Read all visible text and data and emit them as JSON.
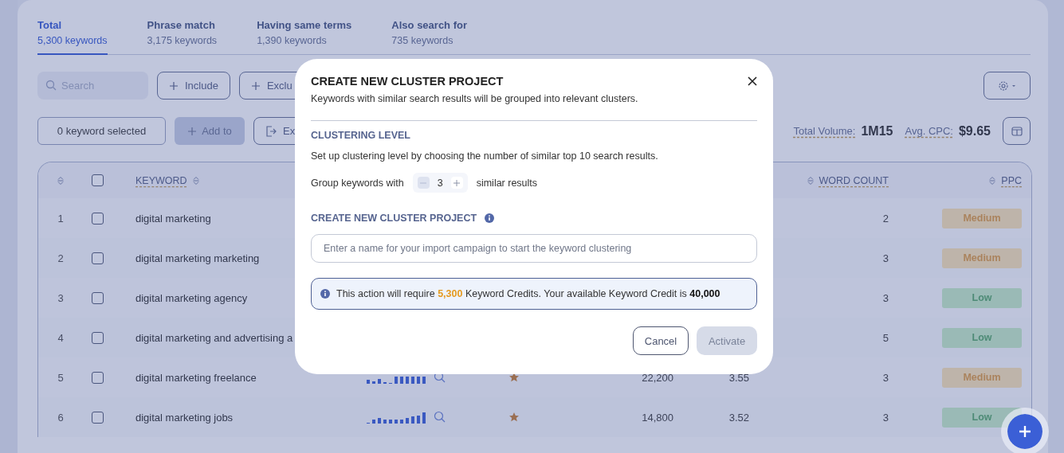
{
  "tabs": [
    {
      "title": "Total",
      "count": "5,300 keywords",
      "selected": true
    },
    {
      "title": "Phrase match",
      "count": "3,175 keywords",
      "selected": false
    },
    {
      "title": "Having same terms",
      "count": "1,390 keywords",
      "selected": false
    },
    {
      "title": "Also search for",
      "count": "735 keywords",
      "selected": false
    }
  ],
  "toolbar": {
    "search_placeholder": "Search",
    "include": "Include",
    "exclude": "Exclu",
    "selected_count": "0 keyword selected",
    "add_to": {
      "label": "Add to",
      "disabled": true
    },
    "export": "Ex",
    "total_volume_label": "Total Volume:",
    "total_volume": "1M15",
    "avg_cpc_label": "Avg. CPC:",
    "avg_cpc": "$9.65"
  },
  "table": {
    "header_checked": false,
    "columns": [
      "KEYWORD",
      "WORD COUNT",
      "PPC"
    ],
    "rows": [
      {
        "num": "1",
        "checked": false,
        "keyword": "digital marketing",
        "word_count": "2",
        "ppc": {
          "label": "Medium",
          "kind": "medium"
        }
      },
      {
        "num": "2",
        "checked": false,
        "keyword": "digital marketing marketing",
        "word_count": "3",
        "ppc": {
          "label": "Medium",
          "kind": "medium"
        }
      },
      {
        "num": "3",
        "checked": false,
        "keyword": "digital marketing agency",
        "word_count": "3",
        "ppc": {
          "label": "Low",
          "kind": "low"
        }
      },
      {
        "num": "4",
        "checked": false,
        "keyword": "digital marketing and advertising a",
        "word_count": "5",
        "ppc": {
          "label": "Low",
          "kind": "low"
        }
      },
      {
        "num": "5",
        "checked": false,
        "keyword": "digital marketing freelance",
        "starred": true,
        "volume": "22,200",
        "cpc": "3.55",
        "word_count": "3",
        "ppc": {
          "label": "Medium",
          "kind": "medium"
        }
      },
      {
        "num": "6",
        "checked": false,
        "keyword": "digital marketing jobs",
        "starred": true,
        "volume": "14,800",
        "cpc": "3.52",
        "word_count": "3",
        "ppc": {
          "label": "Low",
          "kind": "low"
        }
      }
    ]
  },
  "dialog": {
    "title": "CREATE NEW CLUSTER PROJECT",
    "subtitle": "Keywords with similar search results will be grouped into relevant clusters.",
    "section_title": "CLUSTERING LEVEL",
    "section_text": "Set up clustering level by choosing the number of similar top 10 search results.",
    "group_label": "Group keywords with",
    "stepper": {
      "value": "3",
      "minus_disabled": true
    },
    "group_suffix": "similar results",
    "project_label": "CREATE NEW CLUSTER PROJECT",
    "name_placeholder": "Enter a name for your import campaign to start the keyword clustering",
    "notice": {
      "text_1": "This action will require",
      "credits": "5,300",
      "text_2": "Keyword Credits. Your available Keyword Credit is",
      "available": "40,000"
    },
    "cancel": "Cancel",
    "activate": {
      "label": "Activate",
      "disabled": true
    }
  }
}
